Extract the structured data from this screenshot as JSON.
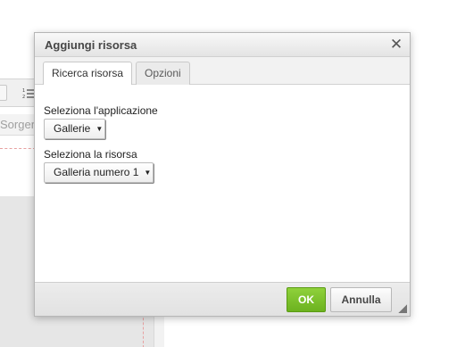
{
  "background_editor": {
    "source_label": "Sorgente",
    "toolbar_icons": [
      "format-button-icon",
      "numbered-list-icon"
    ]
  },
  "dialog": {
    "title": "Aggiungi risorsa",
    "close_icon": "close-icon",
    "tabs": [
      {
        "label": "Ricerca risorsa",
        "active": true
      },
      {
        "label": "Opzioni",
        "active": false
      }
    ],
    "fields": {
      "application": {
        "label": "Seleziona l'applicazione",
        "value": "Gallerie"
      },
      "resource": {
        "label": "Seleziona la risorsa",
        "value": "Galleria numero 1"
      }
    },
    "buttons": {
      "ok": "OK",
      "cancel": "Annulla"
    }
  },
  "colors": {
    "ok_button": "#7cc22a",
    "dialog_title": "#474747",
    "placeholder_dash": "#e8a0a0"
  }
}
